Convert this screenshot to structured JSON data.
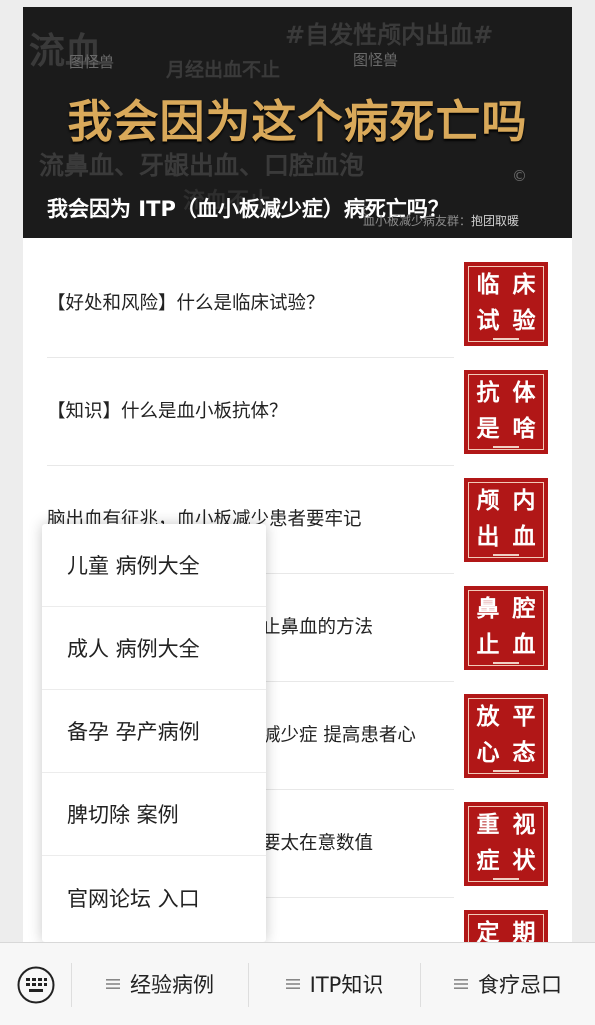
{
  "banner": {
    "main_text": "我会因为这个病死亡吗",
    "caption": "我会因为 ITP（血小板减少症）病死亡吗？",
    "author_prefix": "血小板减少病友群",
    "author_tag": "抱团取暖",
    "background_words": {
      "w1": "流血",
      "w2": "#自发性颅内出血#",
      "w3": "月经出血不止",
      "w4": "流鼻血、牙龈出血、口腔血泡",
      "w5": "流血不止"
    },
    "watermarks": [
      "图怪兽",
      "图怪兽",
      "©",
      "©"
    ]
  },
  "articles": [
    {
      "title": "【好处和风险】什么是临床试验？",
      "thumb": [
        "临",
        "床",
        "试",
        "验"
      ]
    },
    {
      "title": "【知识】什么是血小板抗体？",
      "thumb": [
        "抗",
        "体",
        "是",
        "啥"
      ]
    },
    {
      "title": "脑出血有征兆，血小板减少患者要牢记",
      "thumb": [
        "颅",
        "内",
        "出",
        "血"
      ]
    },
    {
      "title": "止鼻血的方法",
      "thumb": [
        "鼻",
        "腔",
        "止",
        "血"
      ]
    },
    {
      "title": "减少症 提高患者心",
      "thumb": [
        "放",
        "平",
        "心",
        "态"
      ]
    },
    {
      "title": "要太在意数值",
      "thumb": [
        "重",
        "视",
        "症",
        "状"
      ]
    },
    {
      "title": "",
      "thumb": [
        "定",
        "期",
        "",
        ""
      ]
    }
  ],
  "popup_menu": {
    "items": [
      "儿童 病例大全",
      "成人 病例大全",
      "备孕 孕产病例",
      "脾切除 案例",
      "官网论坛 入口"
    ]
  },
  "bottom_bar": {
    "keyboard_icon": "keyboard-icon",
    "menus": [
      "经验病例",
      "ITP知识",
      "食疗忌口"
    ]
  },
  "colors": {
    "banner_bg": "#1b1b1b",
    "banner_gold": "#d9a95a",
    "thumb_red": "#b11717",
    "page_bg": "#ededed"
  }
}
